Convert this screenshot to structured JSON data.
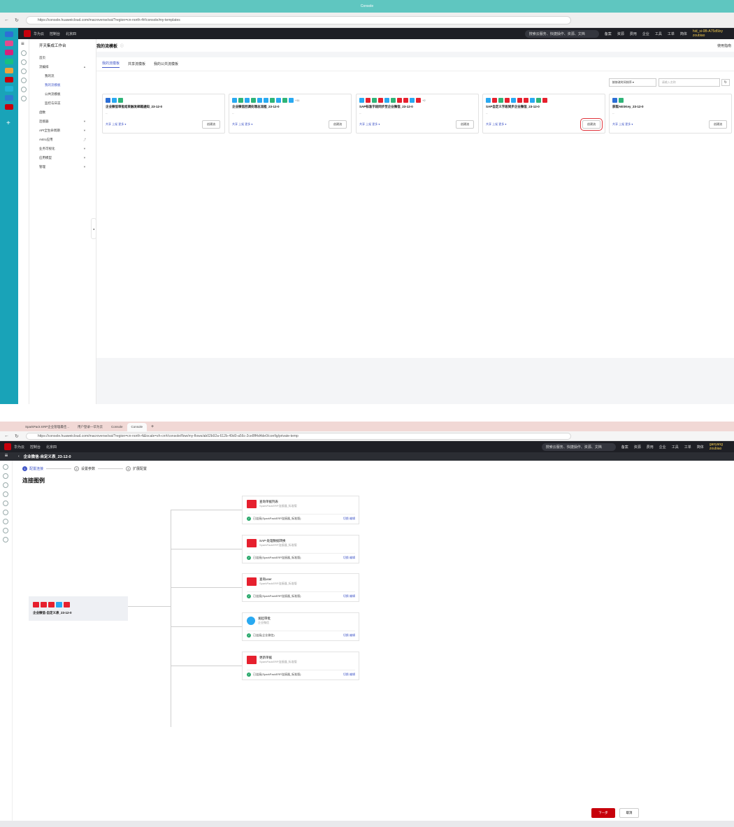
{
  "shot1": {
    "window_title": "Console",
    "url": "https://console.huaweicloud.com/macroverse/ssi/?region=cn-north-4#/console/my-templates",
    "topnav": {
      "brand": "华为云",
      "console": "控制台",
      "region": "北京四",
      "search": "搜索云服务、快捷操作、资源、文档",
      "items": [
        "备案",
        "资源",
        "费用",
        "企业",
        "工具",
        "工单"
      ],
      "lang": "简体",
      "user": "hid_si-0B-A75d5lxy",
      "user_sub": "zoubiao"
    },
    "sidebar": {
      "title": "开天集成工作台",
      "items": [
        {
          "label": "首页",
          "sub": false,
          "active": false,
          "caret": ""
        },
        {
          "label": "流编排",
          "sub": false,
          "active": false,
          "caret": "▲"
        },
        {
          "label": "我的流",
          "sub": true,
          "active": false,
          "caret": ""
        },
        {
          "label": "我的流模板",
          "sub": true,
          "active": true,
          "caret": ""
        },
        {
          "label": "公共流模板",
          "sub": true,
          "active": false,
          "caret": ""
        },
        {
          "label": "监控与日志",
          "sub": true,
          "active": false,
          "caret": ""
        },
        {
          "label": "函数",
          "sub": false,
          "active": false,
          "caret": ""
        },
        {
          "label": "连接器",
          "sub": false,
          "active": false,
          "caret": "▼"
        },
        {
          "label": "API全生命周期",
          "sub": false,
          "active": false,
          "caret": "▼"
        },
        {
          "label": "Astro应用",
          "sub": false,
          "active": false,
          "caret": "⤴"
        },
        {
          "label": "业务可视化",
          "sub": false,
          "active": false,
          "caret": "▼"
        },
        {
          "label": "应用模型",
          "sub": false,
          "active": false,
          "caret": "▼"
        },
        {
          "label": "管理",
          "sub": false,
          "active": false,
          "caret": "▼"
        }
      ]
    },
    "page_title": "我的流模板",
    "help_link": "使用指南",
    "tabs": [
      "我的流模板",
      "共享流模板",
      "我的公共流模板"
    ],
    "sort_label": "按修改时间排序",
    "search_placeholder": "请输入名称",
    "cards": [
      {
        "title": "企业微信审批结束触发邮箱通知_23-12-0",
        "desc": "--",
        "links": "共享  上架  更多 ▾",
        "button": "创建流",
        "extra": ""
      },
      {
        "title": "企业微信回调处理总流程_23-12-0",
        "desc": "--",
        "links": "共享  上架  更多 ▾",
        "button": "创建流",
        "extra": "+11"
      },
      {
        "title": "SAP标准字段同步至企业微信_23-12-0",
        "desc": "--",
        "links": "共享  上架  更多 ▾",
        "button": "创建流",
        "extra": "+2"
      },
      {
        "title": "SAP自定义字段同步企业微信_23-12-0",
        "desc": "--",
        "links": "共享  上架  更多 ▾",
        "button": "创建流",
        "extra": ""
      },
      {
        "title": "获取AESKey_23-12-0",
        "desc": "--",
        "links": "共享  上架  更多 ▾",
        "button": "创建流",
        "extra": ""
      }
    ]
  },
  "shot2": {
    "tabs": [
      "SparkPack ERP企业管理最佳...",
      "用户登录—华为云",
      "Console",
      "Console"
    ],
    "url": "https://console.huaweicloud.com/macroverse/ssi/?region=cn-north-4&locale=zh-cn#/console/flow/my-flows/ab02b92a-612b-49d0-a56c-2ce8ff4d4de0/config/private-temp",
    "topnav": {
      "brand": "华为云",
      "console": "控制台",
      "region": "北京四",
      "search": "搜索云服务、快捷操作、资源、文档",
      "items": [
        "备案",
        "资源",
        "费用",
        "企业",
        "工具",
        "工单"
      ],
      "lang": "简体",
      "user": "ganyang",
      "user_sub": "zoubiao"
    },
    "flow_title": "企业微信-自定义表_23-12-0",
    "steps": [
      "配置连接",
      "设置参数",
      "扩展配置"
    ],
    "section_title": "连接图例",
    "source_title": "企业微信-自定义表_23-12-0",
    "connectors": [
      {
        "name": "查询单据列表",
        "sub": "SparkPackERP连接器_标准版",
        "status": "已连接(SparkPackERP连接器_标准版)",
        "actions": "切换  编辑"
      },
      {
        "name": "SAP-处理数据转换",
        "sub": "SparkPackERP连接器_标准版",
        "status": "已连接(SparkPackERP连接器_标准版)",
        "actions": "切换  编辑"
      },
      {
        "name": "查询user",
        "sub": "SparkPackERP连接器_标准版",
        "status": "已连接(SparkPackERP连接器_标准版)",
        "actions": "切换  编辑"
      },
      {
        "name": "发起审批",
        "sub": "企业微信",
        "status": "已连接(企业微信)",
        "actions": "切换  编辑"
      },
      {
        "name": "更新单据",
        "sub": "SparkPackERP连接器_标准版",
        "status": "已连接(SparkPackERP连接器_标准版)",
        "actions": "切换  编辑"
      }
    ],
    "next_button": "下一步",
    "cancel_button": "取消"
  },
  "colors": {
    "accent": "#4358c8",
    "brand_red": "#c7000b",
    "edge_teal": "#19a3b8"
  }
}
